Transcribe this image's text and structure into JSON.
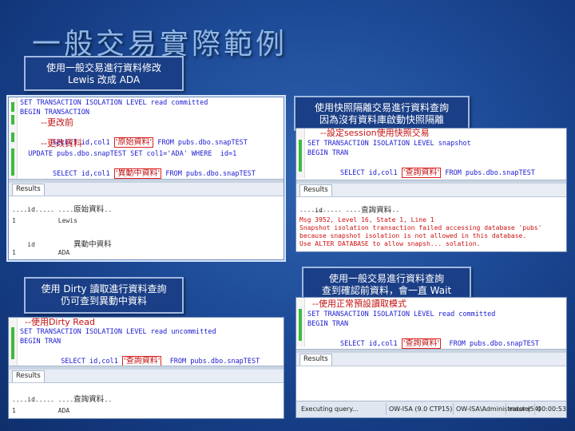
{
  "title": "一般交易實際範例",
  "callouts": {
    "tl": [
      "使用一般交易進行資料修改",
      "Lewis 改成 ADA"
    ],
    "tr": [
      "使用快照隔離交易進行資料查詢",
      "因為沒有資料庫啟動快照隔離"
    ],
    "bl": [
      "使用 Dirty 讀取進行資料查詢",
      "仍可查到異動中資料"
    ],
    "br": [
      "使用一般交易進行資料查詢",
      "查到確認前資料，會一直 Wait"
    ]
  },
  "panel1": {
    "code": {
      "l1": "SET TRANSACTION ISOLATION LEVEL read committed",
      "l2": "BEGIN TRANSACTION",
      "note1": "--更改前",
      "l3a": "  SELECT id,col1 ",
      "box1": "'原始資料'",
      "l3b": " FROM pubs.dbo.snapTEST",
      "note2": "--更改資料",
      "l4": "  UPDATE pubs.dbo.snapTEST SET col1='ADA' WHERE  id=1",
      "l5a": "  SELECT id,col1 ",
      "box2": "'異動中資料'",
      "l5b": " FROM pubs.dbo.snapTEST"
    },
    "tab": "Results",
    "results": {
      "h1a": "id          ",
      "h1b": "原始資料",
      "sep1": "----------- --------------",
      "r1": "1           Lewis",
      "h2a": "id          ",
      "h2b": "異動中資料",
      "r2": "1           ADA"
    }
  },
  "panel2": {
    "code": {
      "note": "--設定session使用快照交易",
      "l1": "SET TRANSACTION ISOLATION LEVEL snapshot",
      "l2": "BEGIN TRAN",
      "l3a": "  SELECT id,col1 ",
      "box": "'查詢資料'",
      "l3b": " FROM pubs.dbo.snapTEST"
    },
    "tab": "Results",
    "results": {
      "ha": "id          ",
      "hb": "查詢資料",
      "sep": "----------- --------------",
      "e1": "Msg 3952, Level 16, State 1, Line 1",
      "e2": "Snapshot isolation transaction failed accessing database 'pubs'",
      "e3": "because snapshot isolation is not allowed in this database.",
      "e4": "Use ALTER DATABASE to allow snapsh... solation."
    }
  },
  "panel3": {
    "code": {
      "note": "--使用Dirty Read",
      "l1": "SET TRANSACTION ISOLATION LEVEL read uncommitted",
      "l2": "BEGIN TRAN",
      "l3a": "    SELECT id,col1 ",
      "box": "'查詢資料'",
      "l3b": "  FROM pubs.dbo.snapTEST"
    },
    "tab": "Results",
    "results": {
      "ha": "id          ",
      "hb": "查詢資料",
      "sep": "----------- --------------",
      "r1": "1           ADA"
    }
  },
  "panel4": {
    "code": {
      "note": "--使用正常預設讀取模式",
      "l1": "SET TRANSACTION ISOLATION LEVEL read committed",
      "l2": "BEGIN TRAN",
      "l3a": "  SELECT id,col1 ",
      "box": "'查詢資料'",
      "l3b": "  FROM pubs.dbo.snapTEST"
    },
    "tab": "Results",
    "status": {
      "s1": "Executing query...",
      "s2": "OW-ISA (9.0 CTP15)",
      "s3": "OW-ISA\\Administrator (54)",
      "s4": "master",
      "s5": "00:00:53"
    }
  }
}
